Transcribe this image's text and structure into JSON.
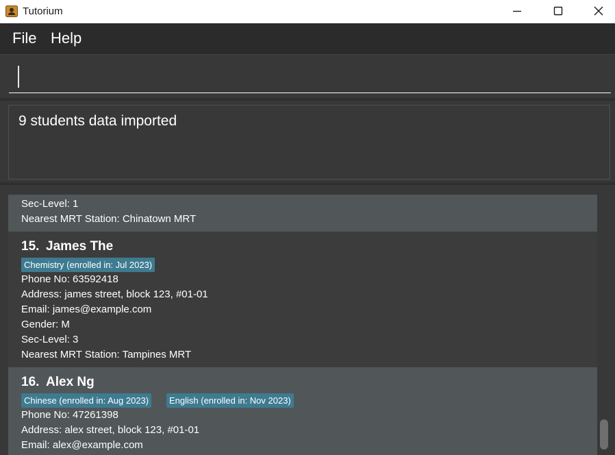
{
  "window": {
    "title": "Tutorium"
  },
  "menu": {
    "file": "File",
    "help": "Help"
  },
  "command": {
    "value": "",
    "placeholder": ""
  },
  "result": {
    "text": "9 students data imported"
  },
  "cards": {
    "partial": {
      "sec_level": "Sec-Level: 1",
      "mrt": "Nearest MRT Station: Chinatown MRT"
    },
    "james": {
      "index": "15.",
      "name": "James The",
      "tags": [
        "Chemistry (enrolled in: Jul 2023)"
      ],
      "phone": "Phone No: 63592418",
      "address": "Address: james street,  block 123,  #01-01",
      "email": "Email: james@example.com",
      "gender": "Gender: M",
      "sec_level": "Sec-Level: 3",
      "mrt": "Nearest MRT Station: Tampines MRT"
    },
    "alex": {
      "index": "16.",
      "name": "Alex Ng",
      "tags": [
        "Chinese (enrolled in: Aug 2023)",
        "English (enrolled in: Nov 2023)"
      ],
      "phone": "Phone No: 47261398",
      "address": "Address: alex street,  block 123,  #01-01",
      "email": "Email: alex@example.com"
    }
  },
  "colors": {
    "tag": "#3e7b91",
    "card_light": "#515658",
    "card_dark": "#3c3c3c",
    "background": "#383838"
  },
  "icons": {
    "app": "contact-book-icon",
    "minimize": "minimize-icon",
    "maximize": "maximize-icon",
    "close": "close-icon"
  }
}
